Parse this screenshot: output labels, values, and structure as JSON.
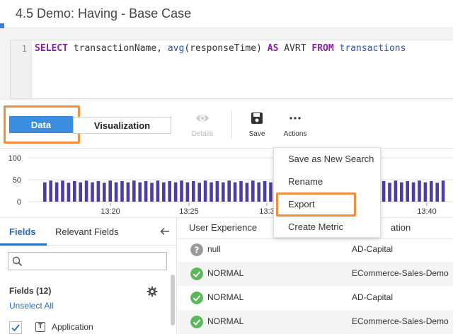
{
  "page": {
    "title": "4.5 Demo: Having - Base Case"
  },
  "editor": {
    "line_number": "1",
    "tokens": {
      "select": "SELECT",
      "col1": " transactionName, ",
      "fn": "avg",
      "arg": "(responseTime) ",
      "as": "AS",
      "alias": " AVRT ",
      "from": "FROM",
      "space": " ",
      "table": "transactions"
    }
  },
  "toolbar": {
    "data_label": "Data",
    "visualization_label": "Visualization",
    "details_label": "Details",
    "save_label": "Save",
    "actions_label": "Actions",
    "details_icon": "eye-icon",
    "save_icon": "floppy-disk-icon",
    "actions_icon": "more-horizontal-icon"
  },
  "chart_data": {
    "type": "bar",
    "y_ticks": [
      "100",
      "50",
      "0"
    ],
    "ylim": [
      0,
      100
    ],
    "x_ticks": [
      "13:20",
      "13:25",
      "13:3",
      "13:40"
    ],
    "values": [
      44,
      48,
      44,
      48,
      43,
      47,
      44,
      48,
      44,
      47,
      43,
      48,
      44,
      47,
      44,
      48,
      44,
      47,
      43,
      48,
      44,
      47,
      44,
      48,
      44,
      47,
      43,
      48,
      44,
      47,
      44,
      48,
      44,
      47,
      43,
      48,
      44,
      47,
      44,
      48,
      44,
      47,
      43,
      48,
      44,
      47,
      44,
      48,
      44,
      47,
      43,
      48,
      44,
      47,
      44,
      48,
      44,
      47,
      43,
      48,
      44,
      47,
      44,
      48,
      44,
      47,
      43,
      48
    ],
    "bar_color": "#4b3fa3"
  },
  "actions_menu": {
    "items": [
      {
        "label": "Save as New Search"
      },
      {
        "label": "Rename"
      },
      {
        "label": "Export"
      },
      {
        "label": "Create Metric"
      }
    ]
  },
  "fields_panel": {
    "tab_fields": "Fields",
    "tab_relevant": "Relevant Fields",
    "collapse_icon": "arrow-left-icon",
    "search_placeholder": "",
    "fields_count": "Fields (12)",
    "unselect_all": "Unselect All",
    "settings_icon": "gear-icon",
    "first_field": {
      "type_letter": "T",
      "name": "Application"
    }
  },
  "table": {
    "headers": [
      "User Experience",
      "ation"
    ],
    "rows": [
      {
        "status": "null",
        "status_kind": "unknown",
        "app": "AD-Capital"
      },
      {
        "status": "NORMAL",
        "status_kind": "normal",
        "app": "ECommerce-Sales-Demo"
      },
      {
        "status": "NORMAL",
        "status_kind": "normal",
        "app": "AD-Capital"
      },
      {
        "status": "NORMAL",
        "status_kind": "normal",
        "app": "ECommerce-Sales-Demo"
      }
    ]
  },
  "colors": {
    "accent": "#3b8de0",
    "highlight": "#ef8f3e",
    "normal_green": "#5cb85c",
    "unknown_gray": "#999999"
  }
}
